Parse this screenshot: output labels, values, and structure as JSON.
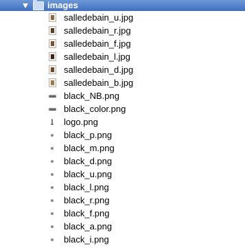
{
  "folder": {
    "name": "images",
    "icon": "folder-icon",
    "disclosure_icon": "disclosure-triangle-open-icon"
  },
  "files": [
    {
      "name": "salledebain_u.jpg",
      "icon": "jpg-thumbnail-icon",
      "thumb_color": "#8a6a44"
    },
    {
      "name": "salledebain_r.jpg",
      "icon": "jpg-thumbnail-icon",
      "thumb_color": "#5a3d22"
    },
    {
      "name": "salledebain_f.jpg",
      "icon": "jpg-thumbnail-icon",
      "thumb_color": "#7a5230"
    },
    {
      "name": "salledebain_l.jpg",
      "icon": "jpg-thumbnail-icon",
      "thumb_color": "#3a2614"
    },
    {
      "name": "salledebain_d.jpg",
      "icon": "jpg-thumbnail-icon",
      "thumb_color": "#6b4a2a"
    },
    {
      "name": "salledebain_b.jpg",
      "icon": "jpg-thumbnail-icon",
      "thumb_color": "#9a7a4a"
    },
    {
      "name": "black_NB.png",
      "icon": "dash-icon"
    },
    {
      "name": "black_color.png",
      "icon": "dash-icon"
    },
    {
      "name": "logo.png",
      "icon": "logo-icon"
    },
    {
      "name": "black_p.png",
      "icon": "dot-icon"
    },
    {
      "name": "black_m.png",
      "icon": "dot-icon"
    },
    {
      "name": "black_d.png",
      "icon": "dot-icon"
    },
    {
      "name": "black_u.png",
      "icon": "dot-icon"
    },
    {
      "name": "black_l.png",
      "icon": "dot-icon"
    },
    {
      "name": "black_r.png",
      "icon": "dot-icon"
    },
    {
      "name": "black_f.png",
      "icon": "dot-icon"
    },
    {
      "name": "black_a.png",
      "icon": "dot-icon"
    },
    {
      "name": "black_i.png",
      "icon": "dot-icon"
    }
  ],
  "colors": {
    "selection_top": "#6d98d6",
    "selection_bottom": "#3f6fc2",
    "text": "#000000"
  }
}
